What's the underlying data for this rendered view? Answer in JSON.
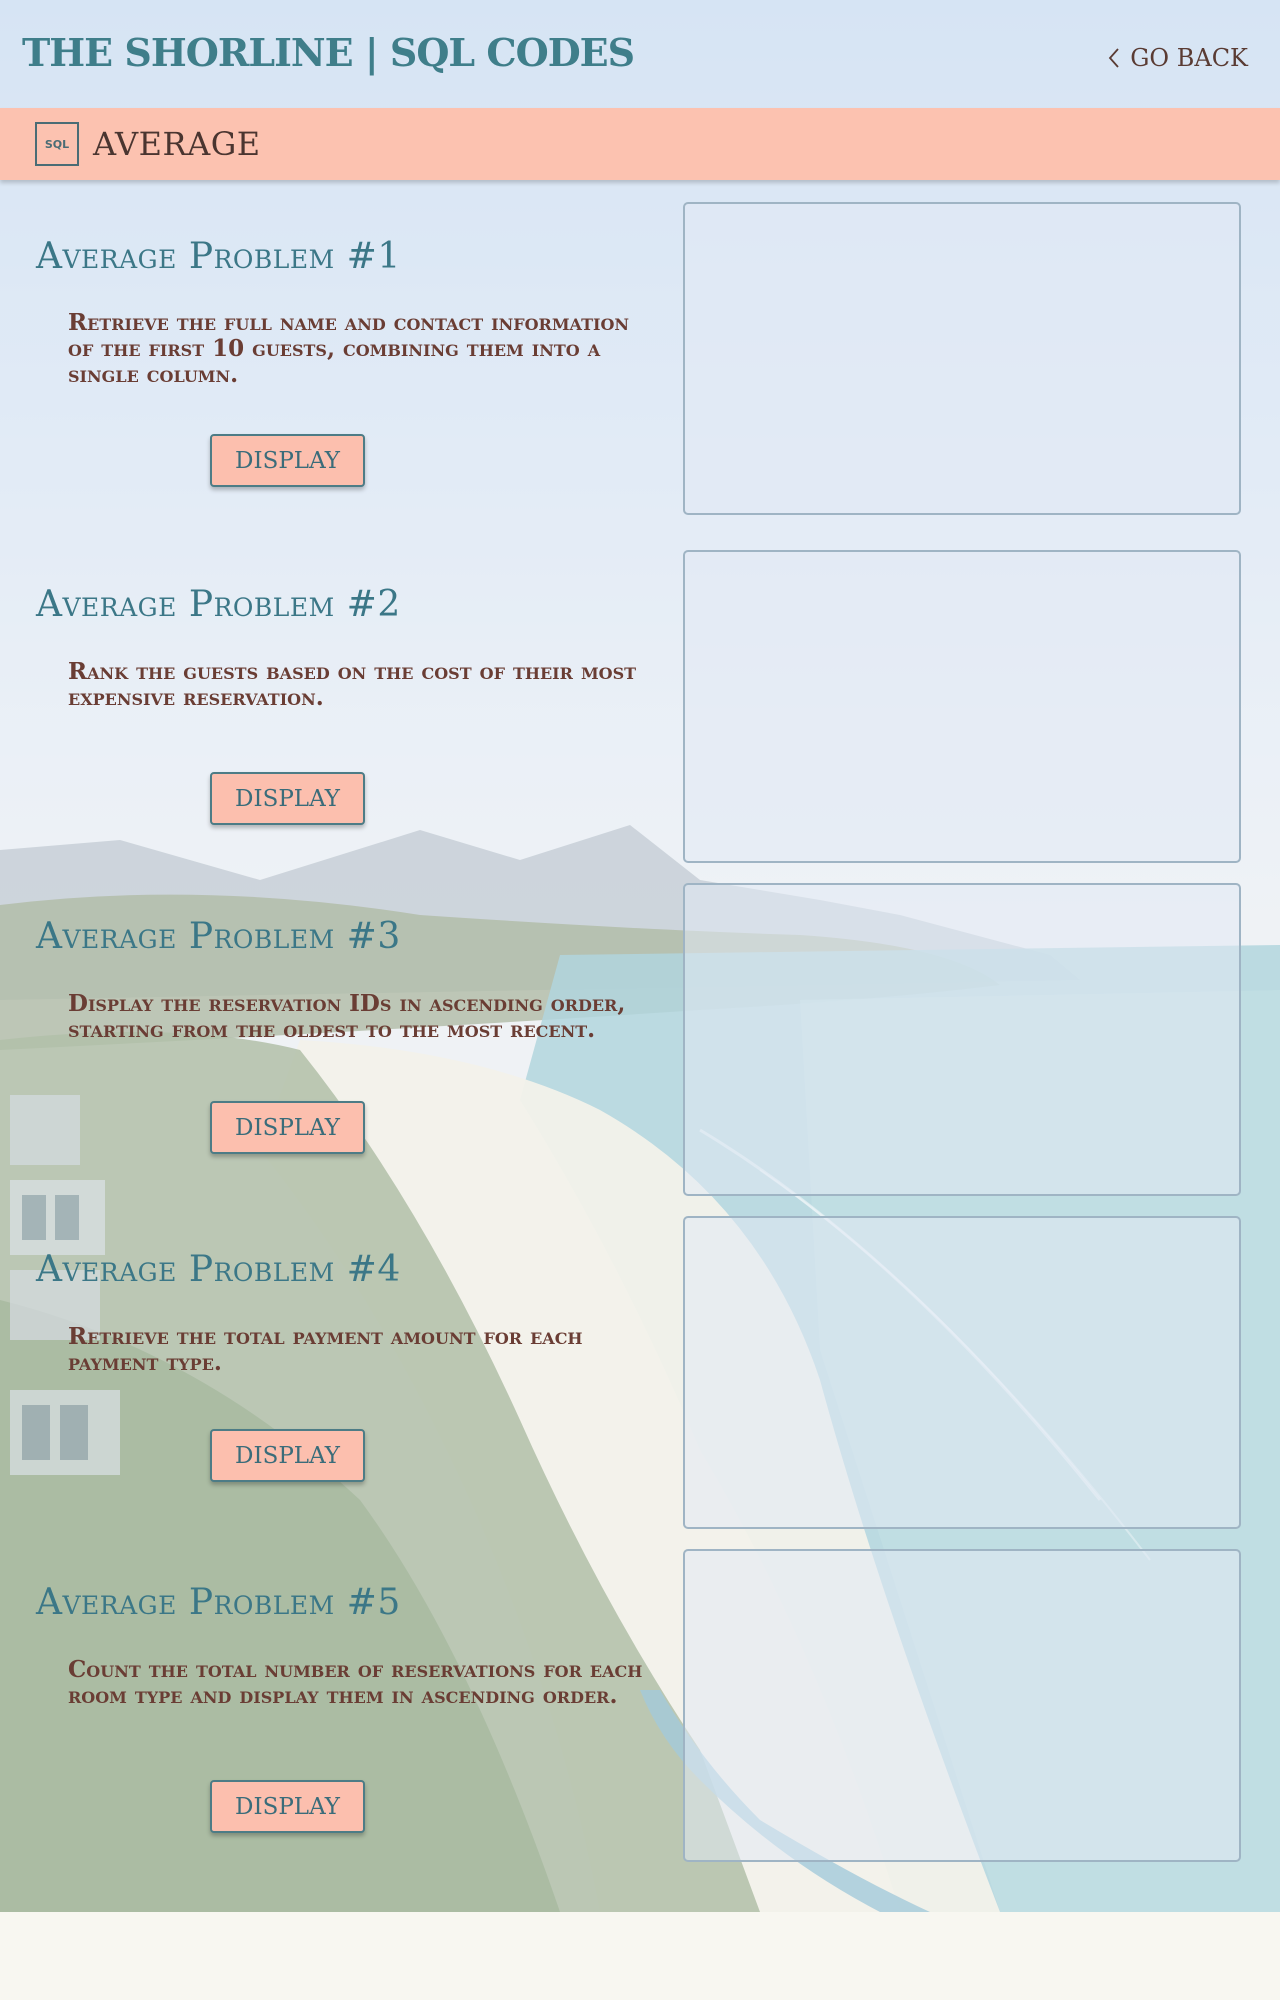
{
  "header": {
    "title": "THE SHORLINE | SQL CODES",
    "go_back_label": "GO BACK"
  },
  "section": {
    "icon_text": "SQL",
    "title": "AVERAGE"
  },
  "problems": [
    {
      "title": "Average Problem #1",
      "description": "Retrieve the full name and contact information of the first 10 guests, combining them into a single column.",
      "button_label": "DISPLAY"
    },
    {
      "title": "Average Problem #2",
      "description": "Rank the guests based on the cost of their most expensive reservation.",
      "button_label": "DISPLAY"
    },
    {
      "title": "Average Problem #3",
      "description": "Display the reservation IDs in ascending order, starting from the oldest to the most recent.",
      "button_label": "DISPLAY"
    },
    {
      "title": "Average Problem #4",
      "description": "Retrieve the total payment amount for each payment type.",
      "button_label": "DISPLAY"
    },
    {
      "title": "Average Problem #5",
      "description": "Count the total number of reservations for each room type and display them in ascending order.",
      "button_label": "DISPLAY"
    }
  ],
  "colors": {
    "accent_peach": "#fcc2b0",
    "title_teal": "#3b7787",
    "text_brown": "#6a3d34"
  }
}
